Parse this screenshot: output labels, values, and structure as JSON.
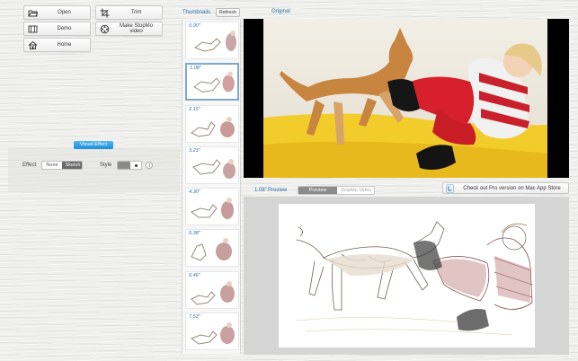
{
  "toolbar": {
    "open_label": "Open",
    "demo_label": "Demo",
    "home_label": "Home",
    "trim_label": "Trim",
    "stopmo_label": "Make StopMo video"
  },
  "visual_effect": {
    "title": "Visual Effect",
    "effect_label": "Effect",
    "effect_options": [
      "None",
      "Sketch"
    ],
    "effect_selected": "Sketch",
    "style_label": "Style",
    "style_selected_index": 1
  },
  "thumbnails": {
    "title": "Thumbnails",
    "refresh_label": "Refresh",
    "items": [
      {
        "time": "0.00\""
      },
      {
        "time": "1.08\""
      },
      {
        "time": "2.15\""
      },
      {
        "time": "3.23\""
      },
      {
        "time": "4.30\""
      },
      {
        "time": "5.38\""
      },
      {
        "time": "6.46\""
      },
      {
        "time": "7.53\""
      }
    ],
    "selected_index": 1
  },
  "original": {
    "title": "Original"
  },
  "preview": {
    "time_label": "1.08\"",
    "title": "Preview",
    "tabs": [
      "Preview",
      "StopMo Video"
    ],
    "active_tab": "Preview",
    "pro_label": "Check out Pro version on Mac App Store"
  },
  "colors": {
    "accent": "#1f8fdb",
    "selected_border": "#7fa9c9",
    "link_blue": "#2c6fa8"
  }
}
